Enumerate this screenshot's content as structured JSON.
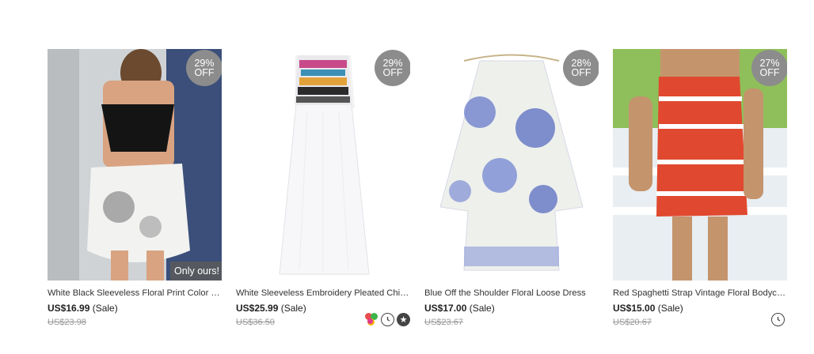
{
  "products": [
    {
      "discount_pct": "29%",
      "discount_off": "OFF",
      "tag": "Only ours!",
      "title": "White Black Sleeveless Floral Print Color Bl...",
      "price": "US$16.99",
      "sale": "(Sale)",
      "old_price": "US$23.98"
    },
    {
      "discount_pct": "29%",
      "discount_off": "OFF",
      "title": "White Sleeveless Embroidery Pleated Chiff...",
      "price": "US$25.99",
      "sale": "(Sale)",
      "old_price": "US$36.50",
      "icons": [
        "color-options-icon",
        "clock-icon",
        "star-icon"
      ]
    },
    {
      "discount_pct": "28%",
      "discount_off": "OFF",
      "title": "Blue Off the Shoulder Floral Loose Dress",
      "price": "US$17.00",
      "sale": "(Sale)",
      "old_price": "US$23.67"
    },
    {
      "discount_pct": "27%",
      "discount_off": "OFF",
      "title": "Red Spaghetti Strap Vintage Floral Bodyco...",
      "price": "US$15.00",
      "sale": "(Sale)",
      "old_price": "US$20.67",
      "icons": [
        "clock-icon"
      ]
    }
  ],
  "colors": {
    "badge": "#8c8c8c",
    "strike": "#9a9a9a"
  }
}
